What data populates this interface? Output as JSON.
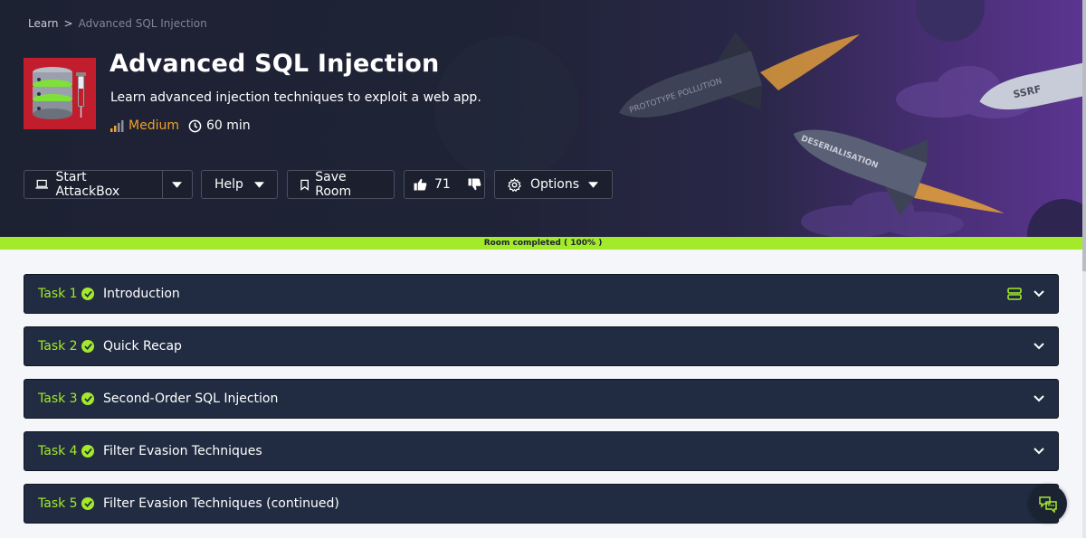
{
  "breadcrumb": {
    "root": "Learn",
    "separator": ">",
    "current": "Advanced SQL Injection"
  },
  "room": {
    "title": "Advanced SQL Injection",
    "description": "Learn advanced injection techniques to exploit a web app.",
    "difficulty": "Medium",
    "duration": "60 min",
    "icon": "database-syringe-icon"
  },
  "art_labels": {
    "rocket1": "PROTOTYPE POLLUTION",
    "rocket2": "SSRF",
    "rocket3": "DESERIALISATION"
  },
  "toolbar": {
    "attackbox_label": "Start AttackBox",
    "help_label": "Help",
    "save_label": "Save Room",
    "likes": "71",
    "options_label": "Options"
  },
  "progress": {
    "label": "Room completed ( 100% )",
    "percent": 100
  },
  "tasks": [
    {
      "number": "Task 1",
      "name": "Introduction",
      "completed": true
    },
    {
      "number": "Task 2",
      "name": "Quick Recap",
      "completed": true
    },
    {
      "number": "Task 3",
      "name": "Second-Order SQL Injection",
      "completed": true
    },
    {
      "number": "Task 4",
      "name": "Filter Evasion Techniques",
      "completed": true
    },
    {
      "number": "Task 5",
      "name": "Filter Evasion Techniques (continued)",
      "completed": true
    }
  ],
  "colors": {
    "accent": "#a3ea2a",
    "difficulty": "#f0a02c",
    "brand_red": "#c11d2c",
    "task_bg": "#212c42"
  }
}
